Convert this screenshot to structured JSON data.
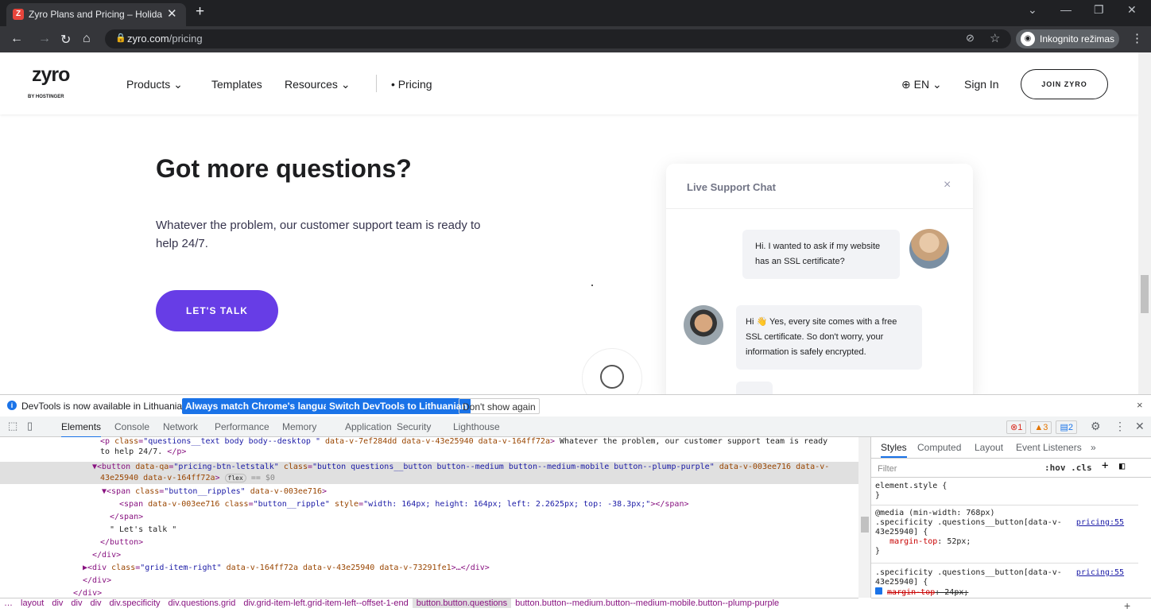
{
  "browser": {
    "tab_title": "Zyro Plans and Pricing – Holiday",
    "tab_close": "✕",
    "new_tab": "+",
    "url_domain": "zyro.com",
    "url_path": "/pricing",
    "incognito_label": "Inkognito režimas"
  },
  "site": {
    "logo": "zyro",
    "logo_sub": "BY HOSTINGER",
    "nav": {
      "products": "Products",
      "templates": "Templates",
      "resources": "Resources",
      "pricing": "• Pricing",
      "lang": "EN",
      "signin": "Sign In",
      "join": "JOIN ZYRO"
    },
    "heading": "Got more questions?",
    "paragraph": "Whatever the problem, our customer support team is ready to help 24/7.",
    "cta": "LET'S TALK",
    "chat": {
      "title": "Live Support Chat",
      "close": "×",
      "msg1": "Hi. I wanted to ask if my website has an SSL certificate?",
      "msg2_a": "Hi 👋 Yes, every site comes with a free",
      "msg2_b": "SSL certificate. So don't worry, your",
      "msg2_c": "information is safely encrypted."
    }
  },
  "devtools": {
    "infobar": {
      "text": "DevTools is now available in Lithuanian!",
      "btn1": "Always match Chrome's language",
      "btn2": "Switch DevTools to Lithuanian",
      "btn3": "Don't show again"
    },
    "tabs": [
      "Elements",
      "Console",
      "Network",
      "Performance",
      "Memory",
      "Application",
      "Security",
      "Lighthouse"
    ],
    "badges": {
      "errors": "1",
      "warnings": "3",
      "messages": "2"
    },
    "styles_tabs": [
      "Styles",
      "Computed",
      "Layout",
      "Event Listeners",
      "»"
    ],
    "filter_placeholder": "Filter",
    "hov": ":hov .cls",
    "crumbs": [
      "…",
      "layout",
      "div",
      "div",
      "div",
      "div.specificity",
      "div.questions.grid",
      "div.grid-item-left.grid-item-left--offset-1-end",
      "button.button.questions",
      "button.button--medium.button--medium-mobile.button--plump-purple"
    ]
  }
}
